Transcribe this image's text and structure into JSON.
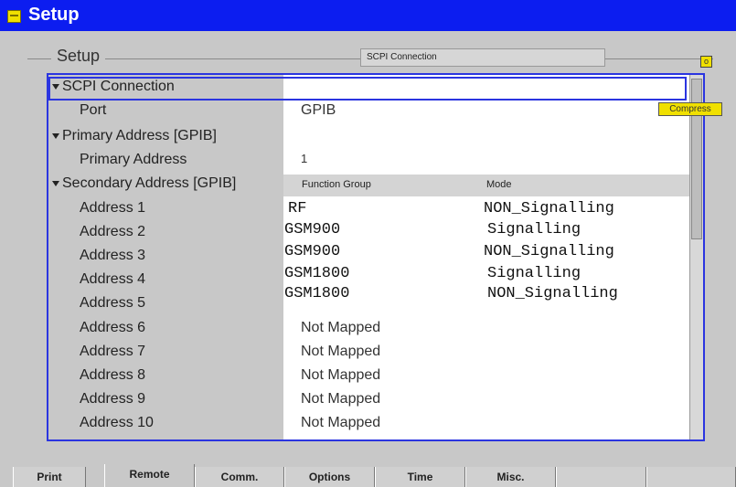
{
  "window": {
    "title": "Setup"
  },
  "frame": {
    "label": "Setup",
    "connection_field": "SCPI Connection"
  },
  "corner_icon": "o",
  "compress_button": "Compress",
  "tree": {
    "scpi_connection": "SCPI Connection",
    "port_label": "Port",
    "primary_group": "Primary Address [GPIB]",
    "primary_label": "Primary Address",
    "secondary_group": "Secondary Address [GPIB]",
    "addresses": [
      "Address 1",
      "Address 2",
      "Address 3",
      "Address 4",
      "Address 5",
      "Address 6",
      "Address 7",
      "Address 8",
      "Address 9",
      "Address 10"
    ]
  },
  "values": {
    "port": "GPIB",
    "primary_address": "1",
    "header_function_group": "Function Group",
    "header_mode": "Mode",
    "mapped": [
      {
        "group": "RF",
        "mode": "NON_Signalling"
      },
      {
        "group": "GSM900",
        "mode": "Signalling"
      },
      {
        "group": "GSM900",
        "mode": "NON_Signalling"
      },
      {
        "group": "GSM1800",
        "mode": "Signalling"
      },
      {
        "group": "GSM1800",
        "mode": "NON_Signalling"
      }
    ],
    "not_mapped": [
      "Not Mapped",
      "Not Mapped",
      "Not Mapped",
      "Not Mapped",
      "Not Mapped"
    ]
  },
  "tabs": [
    "Print",
    "Remote",
    "Comm.",
    "Options",
    "Time",
    "Misc.",
    "",
    ""
  ],
  "colors": {
    "title_bar": "#0c1df0",
    "selection_border": "#2b35e0",
    "accent_yellow": "#f0e000"
  },
  "icons": {
    "title": "setup-window-icon",
    "tree_expand": "triangle-down-icon",
    "corner": "square-yellow-icon"
  }
}
